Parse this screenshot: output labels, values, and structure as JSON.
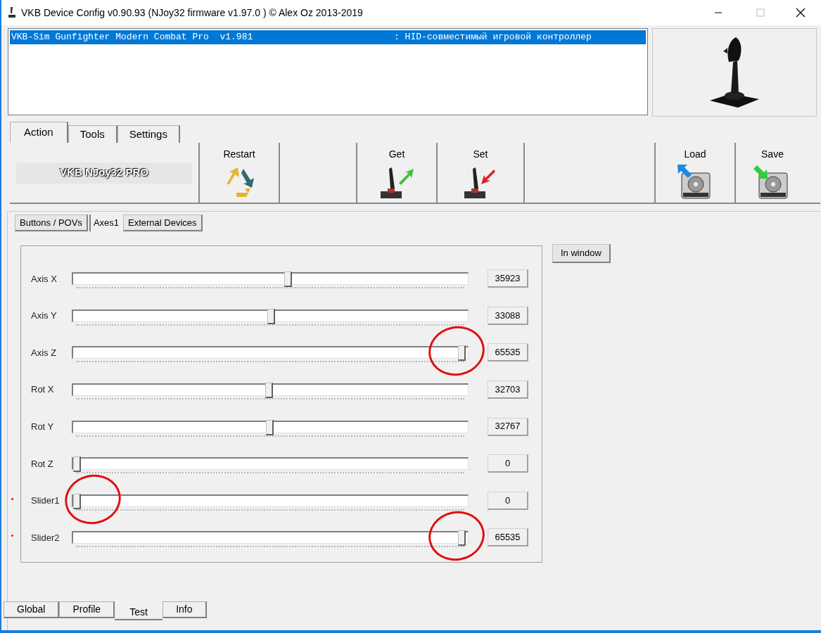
{
  "window": {
    "title": "VKB Device Config v0.90.93 (NJoy32 firmware v1.97.0  ) © Alex Oz 2013-2019"
  },
  "devices": [
    {
      "name": "VKB-Sim Gunfighter Modern Combat Pro  v1.981",
      "description": ": HID-совместимый игровой контроллер",
      "selected": true
    }
  ],
  "tabs": [
    {
      "label": "Action",
      "selected": true
    },
    {
      "label": "Tools",
      "selected": false
    },
    {
      "label": "Settings",
      "selected": false
    }
  ],
  "toolbar": {
    "logo": "VKB NJoy32 PRO",
    "buttons": [
      {
        "label": "Restart",
        "kind": "restart"
      },
      {
        "label": "Get",
        "kind": "get"
      },
      {
        "label": "Set",
        "kind": "set"
      },
      {
        "label": "Load",
        "kind": "load"
      },
      {
        "label": "Save",
        "kind": "save"
      }
    ]
  },
  "sub_tabs": [
    {
      "label": "Buttons / POVs",
      "selected": false
    },
    {
      "label": "Axes1",
      "selected": true
    },
    {
      "label": "External Devices",
      "selected": false
    }
  ],
  "in_window_button": "In window",
  "axes": [
    {
      "label": "Axis X",
      "level": 0.548,
      "value": "35923",
      "circled": false,
      "dotted": false
    },
    {
      "label": "Axis Y",
      "level": 0.505,
      "value": "33088",
      "circled": false,
      "dotted": false
    },
    {
      "label": "Axis Z",
      "level": 1,
      "value": "65535",
      "circled": true,
      "dotted": false
    },
    {
      "label": "Rot X",
      "level": 0.499,
      "value": "32703",
      "circled": false,
      "dotted": false
    },
    {
      "label": "Rot Y",
      "level": 0.5,
      "value": "32767",
      "circled": false,
      "dotted": false
    },
    {
      "label": "Rot Z",
      "level": 0,
      "value": "0",
      "circled": false,
      "dotted": false
    },
    {
      "label": "Slider1",
      "level": 0,
      "value": "0",
      "circled": true,
      "dotted": true
    },
    {
      "label": "Slider2",
      "level": 1,
      "value": "65535",
      "circled": true,
      "dotted": true
    }
  ],
  "bottom_tabs": [
    {
      "label": "Global",
      "selected": false
    },
    {
      "label": "Profile",
      "selected": false
    },
    {
      "label": "Test",
      "selected": true
    },
    {
      "label": "Info",
      "selected": false
    }
  ]
}
